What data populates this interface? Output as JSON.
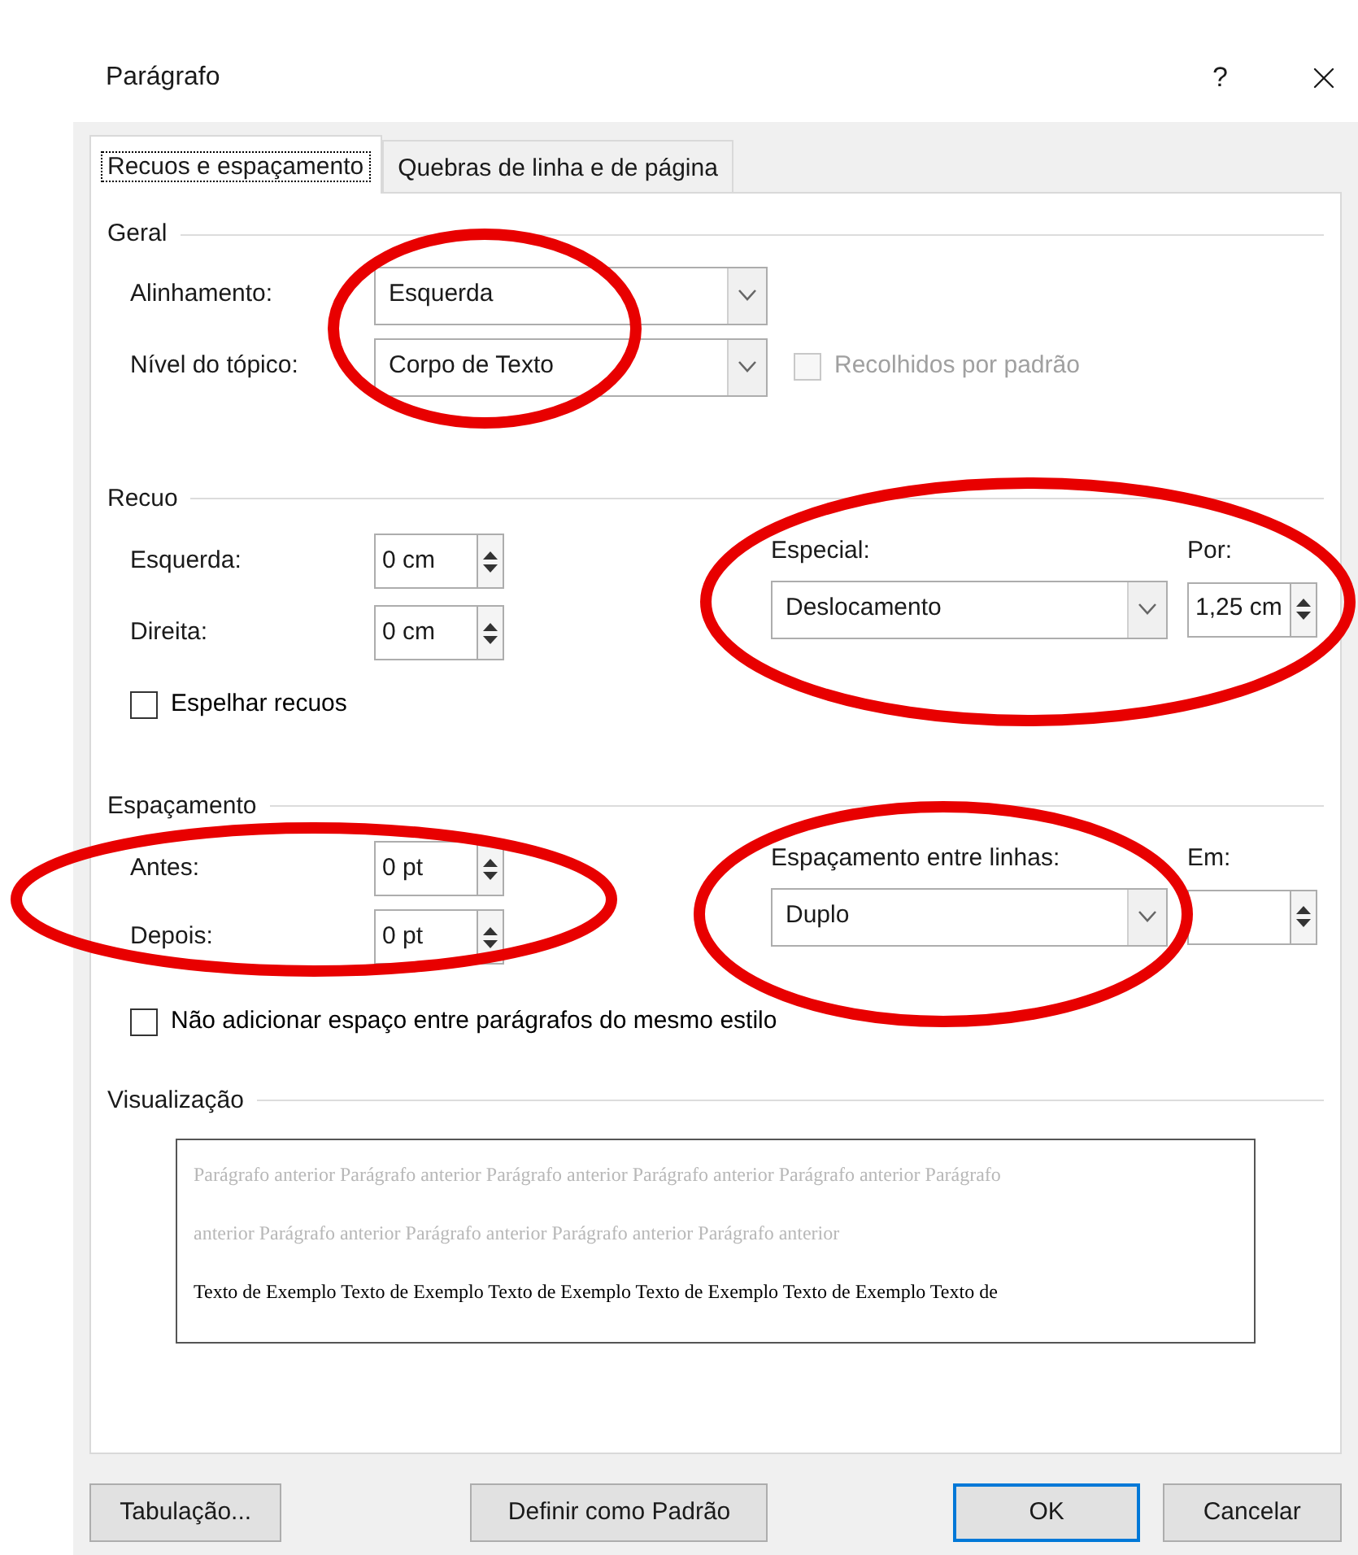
{
  "dialog": {
    "title": "Parágrafo",
    "help": "?"
  },
  "tabs": [
    {
      "label": "Recuos e espaçamento",
      "selected": true
    },
    {
      "label": "Quebras de linha e de página",
      "selected": false
    }
  ],
  "general": {
    "title": "Geral",
    "alignment": {
      "label": "Alinhamento:",
      "value": "Esquerda"
    },
    "outline_level": {
      "label": "Nível do tópico:",
      "value": "Corpo de Texto"
    },
    "collapsed": {
      "label": "Recolhidos por padrão",
      "checked": false,
      "disabled": true
    }
  },
  "indent": {
    "title": "Recuo",
    "left": {
      "label": "Esquerda:",
      "value": "0 cm"
    },
    "right": {
      "label": "Direita:",
      "value": "0 cm"
    },
    "special": {
      "label": "Especial:",
      "value": "Deslocamento"
    },
    "by": {
      "label": "Por:",
      "value": "1,25 cm"
    },
    "mirror": {
      "label": "Espelhar recuos",
      "checked": false,
      "disabled": false
    }
  },
  "spacing": {
    "title": "Espaçamento",
    "before": {
      "label": "Antes:",
      "value": "0 pt"
    },
    "after": {
      "label": "Depois:",
      "value": "0 pt"
    },
    "line_spacing": {
      "label": "Espaçamento entre linhas:",
      "value": "Duplo"
    },
    "at": {
      "label": "Em:"
    },
    "no_space": {
      "label": "Não adicionar espaço entre parágrafos do mesmo estilo",
      "checked": false,
      "disabled": false
    }
  },
  "preview": {
    "title": "Visualização",
    "previous_lines": [
      "Parágrafo anterior Parágrafo anterior Parágrafo anterior Parágrafo anterior Parágrafo anterior Parágrafo",
      "anterior Parágrafo anterior Parágrafo anterior Parágrafo anterior Parágrafo anterior"
    ],
    "sample_line": "Texto de Exemplo Texto de Exemplo Texto de Exemplo Texto de Exemplo Texto de Exemplo Texto de"
  },
  "buttons": [
    {
      "label": "Tabulação...",
      "default": false
    },
    {
      "label": "Definir como Padrão",
      "default": false
    },
    {
      "label": "OK",
      "default": true
    },
    {
      "label": "Cancelar",
      "default": false
    }
  ]
}
